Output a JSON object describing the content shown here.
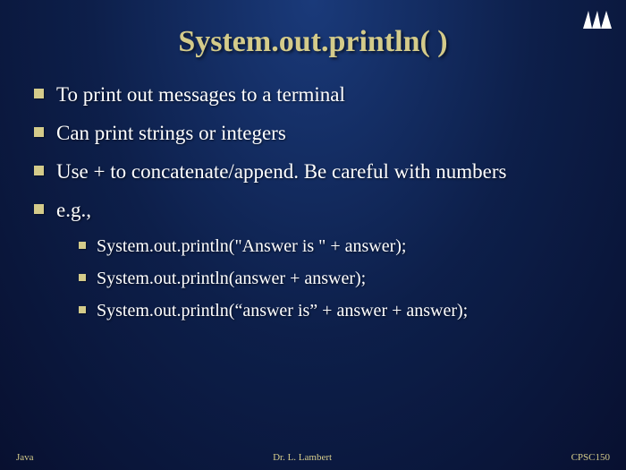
{
  "title": "System.out.println( )",
  "bullets": [
    "To print out messages to a terminal",
    "Can print strings or integers",
    "Use + to concatenate/append.  Be careful with numbers",
    "e.g.,"
  ],
  "subBullets": [
    "System.out.println(\"Answer is \" + answer);",
    "System.out.println(answer + answer);",
    "System.out.println(“answer is” + answer + answer);"
  ],
  "footer": {
    "left": "Java",
    "center": "Dr. L.  Lambert",
    "right": "CPSC150"
  }
}
